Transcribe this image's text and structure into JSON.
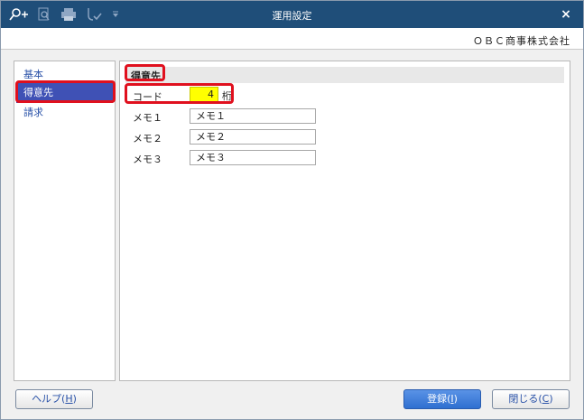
{
  "window": {
    "title": "運用設定",
    "close_glyph": "×"
  },
  "toolbar": {
    "icons": [
      "search-add-icon",
      "magnifier-icon",
      "printer-icon",
      "tool-check-icon",
      "dropdown-icon"
    ]
  },
  "company": "ＯＢＣ商事株式会社",
  "nav": {
    "items": [
      {
        "label": "基本"
      },
      {
        "label": "得意先"
      },
      {
        "label": "請求"
      }
    ],
    "selected_index": 1
  },
  "section": {
    "title": "得意先",
    "code": {
      "label": "コード",
      "value": "4",
      "unit": "桁"
    },
    "memos": [
      {
        "label": "メモ１",
        "value": "メモ１"
      },
      {
        "label": "メモ２",
        "value": "メモ２"
      },
      {
        "label": "メモ３",
        "value": "メモ３"
      }
    ]
  },
  "buttons": {
    "help": {
      "label": "ヘルプ(",
      "key": "H",
      "tail": ")"
    },
    "register": {
      "label": "登録(",
      "key": "I",
      "tail": ")"
    },
    "close": {
      "label": "閉じる(",
      "key": "C",
      "tail": ")"
    }
  }
}
